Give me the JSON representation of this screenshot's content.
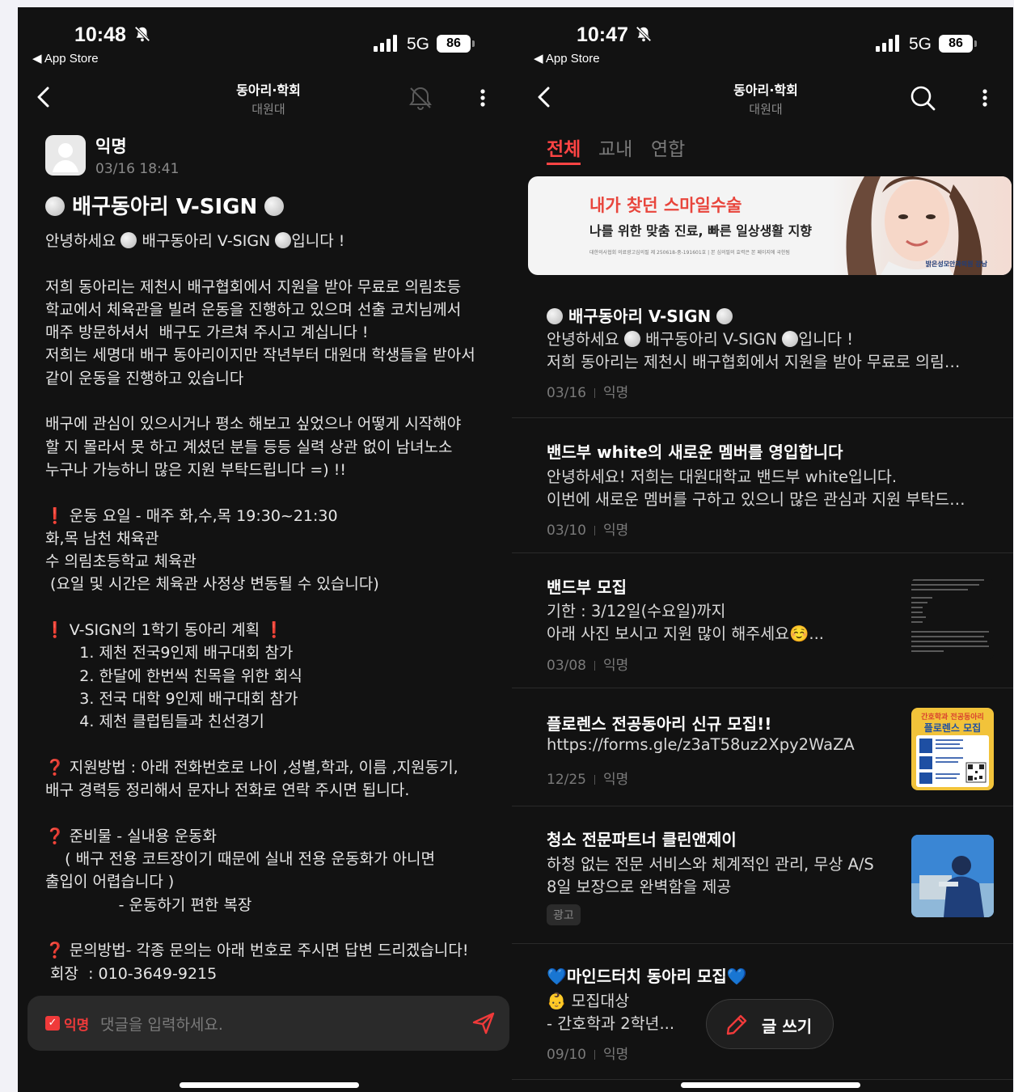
{
  "status": {
    "left_time": "10:48",
    "right_time": "10:47",
    "back_label": "◀ App Store",
    "network": "5G",
    "battery": "86"
  },
  "nav": {
    "title": "동아리·학회",
    "subtitle": "대원대"
  },
  "post": {
    "author": "익명",
    "date": "03/16 18:41",
    "title": "배구동아리 V-SIGN",
    "greeting_pre": "안녕하세요 ",
    "greeting_mid": " 배구동아리 V-SIGN ",
    "greeting_post": "입니다 !",
    "para1": "저희 동아리는 제천시 배구협회에서 지원을 받아 무료로 의림초등\n학교에서 체육관을 빌려 운동을 진행하고 있으며 선출 코치님께서\n매주 방문하셔서  배구도 가르쳐 주시고 계십니다 !\n저희는 세명대 배구 동아리이지만 작년부터 대원대 학생들을 받아서\n같이 운동을 진행하고 있습니다",
    "para2": "배구에 관심이 있으시거나 평소 해보고 싶었으나 어떻게 시작해야\n할 지 몰라서 못 하고 계셨던 분들 등등 실력 상관 없이 남녀노소\n누구나 가능하니 많은 지원 부탁드립니다 =) !!",
    "schedule_head": " 운동 요일 - 매주 화,수,목 19:30~21:30",
    "schedule_rest": "화,목 남천 채육관\n수 의림초등학교 체육관\n (요일 및 시간은 체육관 사정상 변동될 수 있습니다)",
    "plan_head": " V-SIGN의 1학기 동아리 계획 ",
    "plan_items": "       1. 제천 전국9인제 배구대회 참가\n       2. 한달에 한번씩 친목을 위한 회식\n       3. 전국 대학 9인제 배구대회 참가\n       4. 제천 클럽팀들과 친선경기",
    "apply_head": " 지원방법 : 아래 전화번호로 나이 ,성별,학과, 이름 ,지원동기,",
    "apply_rest": "배구 경력등 정리해서 문자나 전화로 연락 주시면 됩니다.",
    "prep_head": " 준비물 - 실내용 운동화",
    "prep_rest": "    ( 배구 전용 코트장이기 때문에 실내 전용 운동화가 아니면\n출입이 어렵습니다 )\n               - 운동하기 편한 복장",
    "contact_head": " 문의방법- 각종 문의는 아래 번호로 주시면 답변 드리겠습니다!",
    "contact_rest": " 회장  : 010-3649-9215"
  },
  "comment": {
    "anon_label": "익명",
    "placeholder": "댓글을 입력하세요."
  },
  "tabs": [
    "전체",
    "교내",
    "연합"
  ],
  "ad": {
    "headline": "내가 찾던 스마일수술",
    "subline": "나를 위한 맞춤 진료, 빠른 일상생활 지향",
    "fine": "대한의사협회 의료광고심의필 제 250618-중-191601호 | 본 심의필의 효력은 본 페이지에 국한됨",
    "logo": "밝은성모안과의원 강남"
  },
  "list": [
    {
      "title": "배구동아리 V-SIGN",
      "line1_pre": "안녕하세요 ",
      "line1_mid": " 배구동아리 V-SIGN ",
      "line1_post": "입니다 !",
      "line2": "저희 동아리는 제천시 배구협회에서 지원을 받아 무료로 의림…",
      "date": "03/16",
      "author": "익명"
    },
    {
      "title": "밴드부 white의 새로운 멤버를 영입합니다",
      "line1": "안녕하세요! 저희는 대원대학교 밴드부 white입니다.",
      "line2": "이번에 새로운 멤버를 구하고 있으니 많은 관심과 지원 부탁드…",
      "date": "03/10",
      "author": "익명"
    },
    {
      "title": "밴드부 모집",
      "line1": "기한 : 3/12일(수요일)까지",
      "line2": "아래 사진 보시고 지원 많이 해주세요☺️...",
      "date": "03/08",
      "author": "익명"
    },
    {
      "title": "플로렌스 전공동아리 신규 모집!!",
      "line1": "https://forms.gle/z3aT58uz2Xpy2WaZA",
      "date": "12/25",
      "author": "익명",
      "thumb_head": "간호학과 전공동아리",
      "thumb_title": "플로렌스 모집"
    },
    {
      "title": "청소 전문파트너 클린앤제이",
      "line1": "하청 없는 전문 서비스와 체계적인 관리, 무상 A/S",
      "line2": "8일 보장으로 완벽함을 제공",
      "badge": "광고"
    },
    {
      "title_pre": "💙",
      "title": "마인드터치 동아리 모집",
      "title_post": "💙",
      "line1": "👶 모집대상",
      "line2": "- 간호학과 2학년...",
      "date": "09/10",
      "author": "익명"
    }
  ],
  "fab": {
    "label": "글 쓰기"
  }
}
